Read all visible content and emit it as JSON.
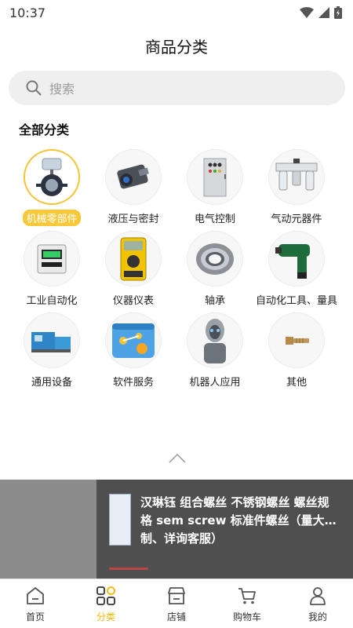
{
  "status": {
    "time": "10:37"
  },
  "header": {
    "title": "商品分类"
  },
  "search": {
    "placeholder": "搜索"
  },
  "section": {
    "title": "全部分类"
  },
  "categories": [
    {
      "label": "机械零部件",
      "icon": "butterfly-valve-icon",
      "active": true
    },
    {
      "label": "液压与密封",
      "icon": "hydraulic-motor-icon"
    },
    {
      "label": "电气控制",
      "icon": "control-cabinet-icon"
    },
    {
      "label": "气动元器件",
      "icon": "air-filter-unit-icon"
    },
    {
      "label": "工业自动化",
      "icon": "pressure-sensor-icon"
    },
    {
      "label": "仪器仪表",
      "icon": "multimeter-icon"
    },
    {
      "label": "轴承",
      "icon": "bearing-icon"
    },
    {
      "label": "自动化工具、量具",
      "icon": "impact-wrench-icon"
    },
    {
      "label": "通用设备",
      "icon": "industrial-equipment-icon"
    },
    {
      "label": "软件服务",
      "icon": "software-service-icon"
    },
    {
      "label": "机器人应用",
      "icon": "robot-icon"
    },
    {
      "label": "其他",
      "icon": "bolt-icon"
    }
  ],
  "promo": {
    "line1": "汉琳钰 组合螺丝 不锈钢螺丝 螺丝规",
    "line2": "格 sem screw 标准件螺丝（量大…",
    "line3": "制、详询客服）"
  },
  "nav": [
    {
      "label": "首页",
      "icon": "home-icon"
    },
    {
      "label": "分类",
      "icon": "category-icon",
      "active": true
    },
    {
      "label": "店铺",
      "icon": "store-icon"
    },
    {
      "label": "购物车",
      "icon": "cart-icon"
    },
    {
      "label": "我的",
      "icon": "user-icon"
    }
  ],
  "colors": {
    "accent": "#f5b800",
    "active_label_bg": "#f8c838"
  }
}
